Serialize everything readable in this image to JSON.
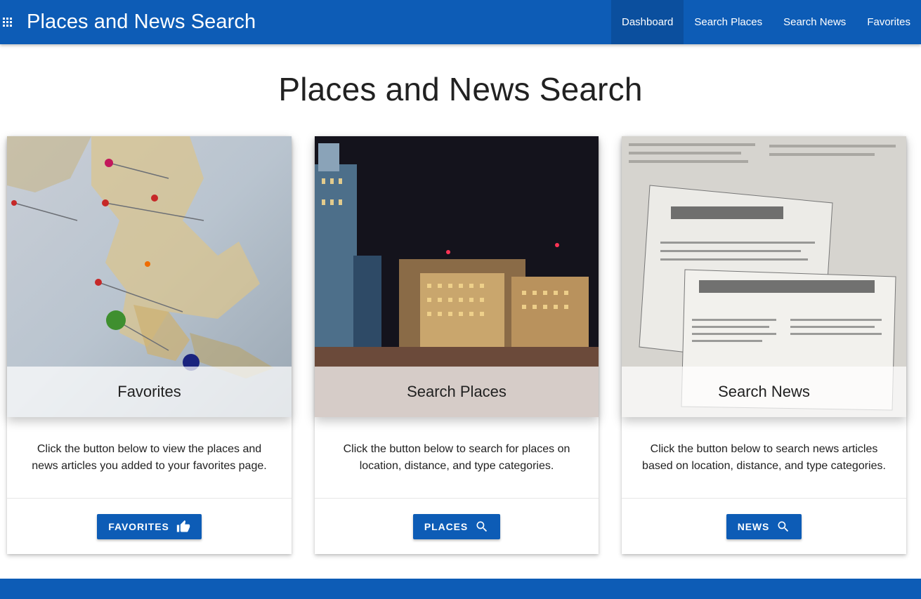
{
  "header": {
    "apps_icon": "apps-grid-icon",
    "brand": "Places and News Search",
    "nav": [
      {
        "label": "Dashboard",
        "active": true
      },
      {
        "label": "Search Places",
        "active": false
      },
      {
        "label": "Search News",
        "active": false
      },
      {
        "label": "Favorites",
        "active": false
      }
    ]
  },
  "main": {
    "title": "Places and News Search",
    "cards": [
      {
        "image": "map-with-pins-image",
        "caption": "Favorites",
        "text": "Click the button below to view the places and news articles you added to your favorites page.",
        "button_label": "FAVORITES",
        "button_icon": "thumb-up-icon"
      },
      {
        "image": "city-night-buildings-image",
        "caption": "Search Places",
        "text": "Click the button below to search for places on location, distance, and type categories.",
        "button_label": "PLACES",
        "button_icon": "search-icon"
      },
      {
        "image": "newspapers-collage-image",
        "caption": "Search News",
        "text": "Click the button below to search news articles based on location, distance, and type categories.",
        "button_label": "NEWS",
        "button_icon": "search-icon"
      }
    ]
  },
  "colors": {
    "primary": "#0d5cb6",
    "nav_active": "#0b4f9e"
  }
}
